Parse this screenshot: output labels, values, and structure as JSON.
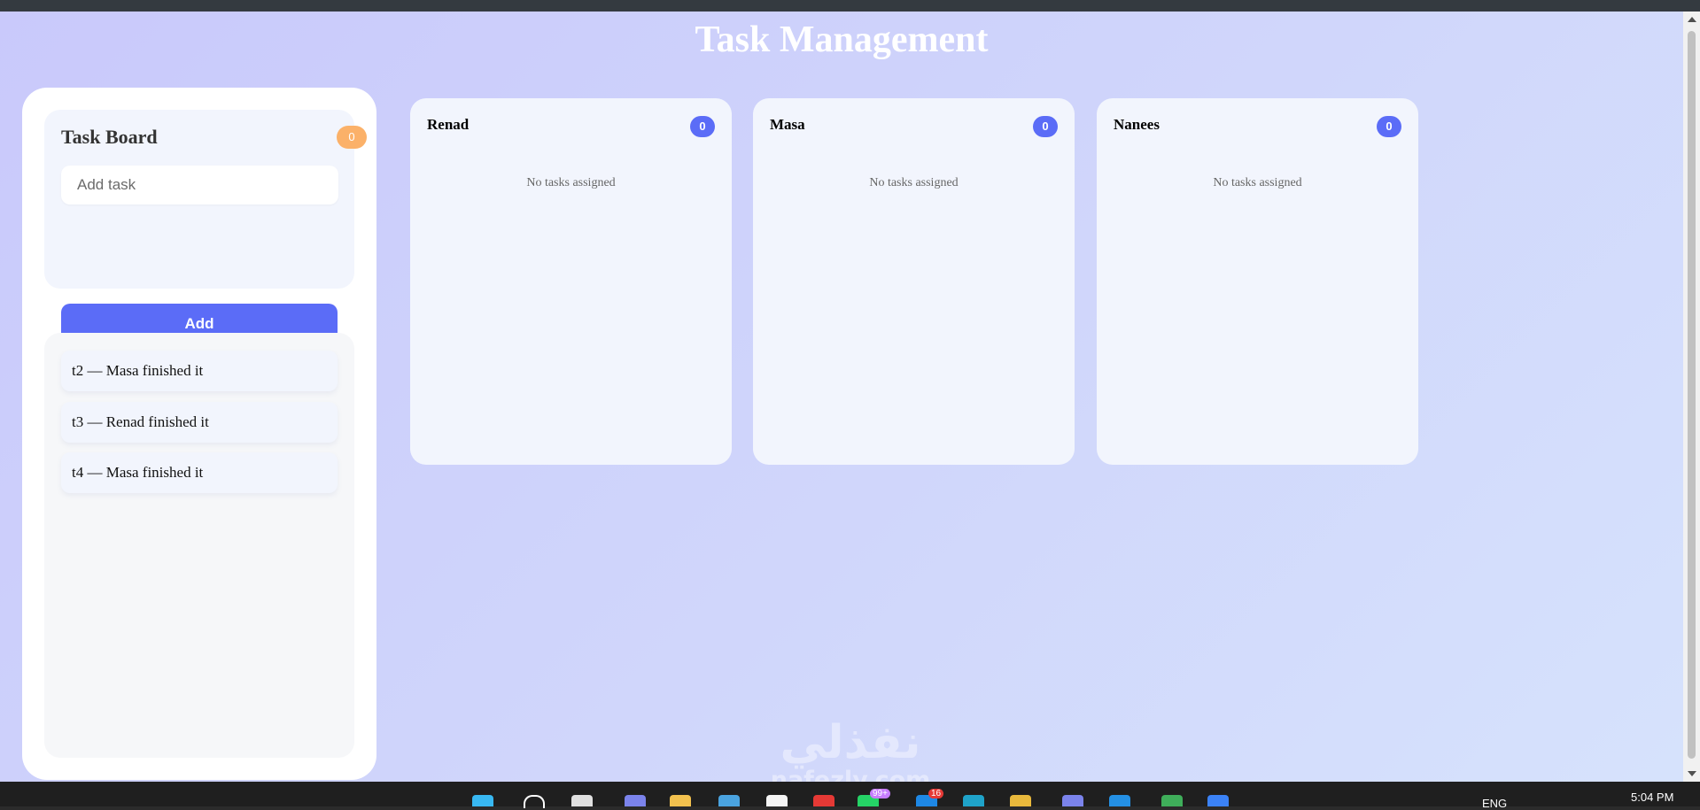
{
  "app": {
    "title": "Task Management"
  },
  "board": {
    "title": "Task Board",
    "count": "0",
    "input_placeholder": "Add task",
    "input_value": "",
    "add_label": "Add"
  },
  "history": {
    "items": [
      {
        "text": "t2 — Masa finished it"
      },
      {
        "text": "t3 — Renad finished it"
      },
      {
        "text": "t4 — Masa finished it"
      }
    ]
  },
  "columns": [
    {
      "name": "Renad",
      "count": "0",
      "empty_text": "No tasks assigned"
    },
    {
      "name": "Masa",
      "count": "0",
      "empty_text": "No tasks assigned"
    },
    {
      "name": "Nanees",
      "count": "0",
      "empty_text": "No tasks assigned"
    }
  ],
  "watermark": {
    "arabic": "نفذلي",
    "latin": "nafezly.com"
  },
  "taskbar": {
    "icons": [
      "windows-start-icon",
      "search-icon",
      "task-view-icon",
      "teams-icon",
      "file-explorer-icon",
      "calculator-icon",
      "calendar-icon",
      "youtube-icon",
      "whatsapp-icon",
      "mail-icon",
      "edge-icon",
      "chrome-icon",
      "teams-work-icon",
      "vscode-icon",
      "maps-icon",
      "copilot-icon"
    ],
    "badges": {
      "whatsapp": "99+",
      "mail": "16"
    },
    "language": "ENG",
    "time": "5:04 PM"
  },
  "colors": {
    "accent": "#5b6cf7",
    "count_badge": "#fbb169",
    "background_start": "#c9c9fb",
    "background_end": "#d6e2fc",
    "card": "#f2f5fd"
  }
}
